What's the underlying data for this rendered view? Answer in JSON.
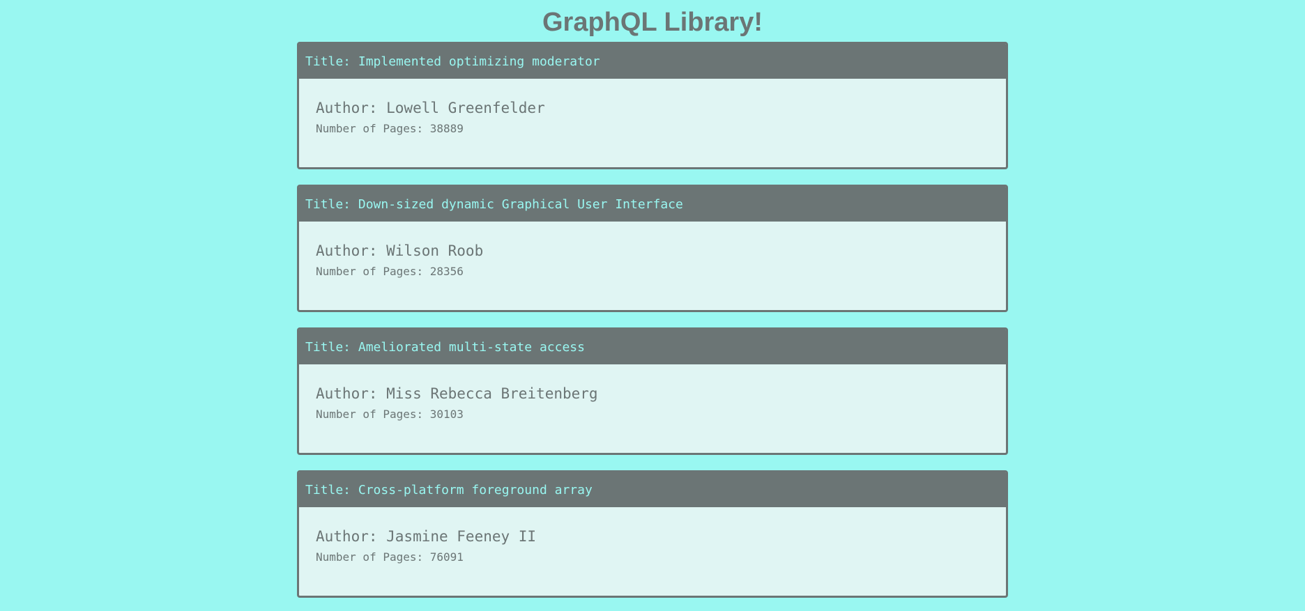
{
  "page": {
    "title": "GraphQL Library!"
  },
  "colors": {
    "background": "#99f7f1",
    "card_header": "#6b7575",
    "card_body": "#e0f5f3",
    "text": "#6b7575",
    "header_text": "#99f7f1"
  },
  "books": [
    {
      "title": "Title: Implemented optimizing moderator",
      "author": "Author: Lowell Greenfelder",
      "pages": "Number of Pages: 38889"
    },
    {
      "title": "Title: Down-sized dynamic Graphical User Interface",
      "author": "Author: Wilson Roob",
      "pages": "Number of Pages: 28356"
    },
    {
      "title": "Title: Ameliorated multi-state access",
      "author": "Author: Miss Rebecca Breitenberg",
      "pages": "Number of Pages: 30103"
    },
    {
      "title": "Title: Cross-platform foreground array",
      "author": "Author: Jasmine Feeney II",
      "pages": "Number of Pages: 76091"
    }
  ]
}
